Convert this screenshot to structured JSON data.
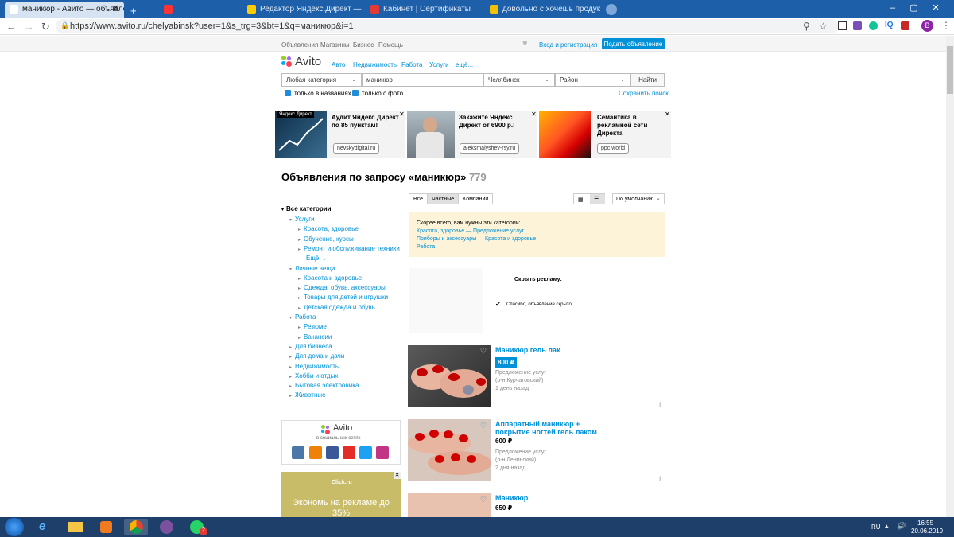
{
  "browser": {
    "tabs": [
      {
        "label": "маникюр - Авито — объявлени"
      },
      {
        "label": ""
      },
      {
        "label": "Редактор Яндекс.Директ — Сер"
      },
      {
        "label": "Кабинет | Сертификаты"
      },
      {
        "label": "довольно с хочешь продукт д..."
      },
      {
        "label": ""
      }
    ],
    "url": "https://www.avito.ru/chelyabinsk?user=1&s_trg=3&bt=1&q=маникюр&i=1",
    "profile_letter": "В"
  },
  "topnav": {
    "links": [
      "Объявления",
      "Магазины",
      "Бизнес",
      "Помощь"
    ],
    "login": "Вход и регистрация",
    "post_button": "Подать объявление"
  },
  "header": {
    "logo": "Avito",
    "menu": [
      "Авто",
      "Недвижимость",
      "Работа",
      "Услуги",
      "ещё..."
    ]
  },
  "search": {
    "category": "Любая категория",
    "query": "маникюр",
    "city": "Челябинск",
    "district": "Район",
    "submit": "Найти",
    "only_titles": "только в названиях",
    "only_photo": "только с фото",
    "save_search": "Сохранить поиск"
  },
  "ads": [
    {
      "badge": "Яндекс.Директ",
      "title": "Аудит Яндекс Директ по 85 пунктам!",
      "button": "nevskydigital.ru"
    },
    {
      "title": "Закажите Яндекс Директ от 6900 р.!",
      "button": "aleksmalyshev-rsy.ru"
    },
    {
      "title": "Семантика в рекламной сети Директа",
      "button": "ppc.world"
    }
  ],
  "results": {
    "heading": "Объявления по запросу «маникюр»",
    "count": "779",
    "seller_tabs": [
      "Все",
      "Частные",
      "Компании"
    ],
    "sort": "По умолчанию"
  },
  "suggest": {
    "title": "Скорее всего, вам нужны эти категории:",
    "items": [
      "Красота, здоровье — Предложение услуг",
      "Приборы и аксессуары — Красота и здоровье",
      "Работа"
    ]
  },
  "hidden_ad": {
    "title": "Скрыть рекламу:",
    "thanks": "Спасибо, объявление скрыто."
  },
  "sidebar": {
    "root": "Все категории",
    "items": [
      {
        "label": "Услуги",
        "level": 1
      },
      {
        "label": "Красота, здоровье",
        "level": 2
      },
      {
        "label": "Обучение, курсы",
        "level": 2
      },
      {
        "label": "Ремонт и обслуживание техники",
        "level": 2
      },
      {
        "label": "Ещё",
        "level": 2
      },
      {
        "label": "Личные вещи",
        "level": 1
      },
      {
        "label": "Красота и здоровье",
        "level": 2
      },
      {
        "label": "Одежда, обувь, аксессуары",
        "level": 2
      },
      {
        "label": "Товары для детей и игрушки",
        "level": 2
      },
      {
        "label": "Детская одежда и обувь",
        "level": 2
      },
      {
        "label": "Работа",
        "level": 1
      },
      {
        "label": "Резюме",
        "level": 2
      },
      {
        "label": "Вакансии",
        "level": 2
      },
      {
        "label": "Для бизнеса",
        "level": 1
      },
      {
        "label": "Для дома и дачи",
        "level": 1
      },
      {
        "label": "Недвижимость",
        "level": 1
      },
      {
        "label": "Хобби и отдых",
        "level": 1
      },
      {
        "label": "Бытовая электроника",
        "level": 1
      },
      {
        "label": "Животные",
        "level": 1
      }
    ]
  },
  "social": {
    "logo": "Avito",
    "caption": "в социальных сетях"
  },
  "promo": {
    "brand": "Click.ru",
    "text": "Экономь на рекламе до 35%"
  },
  "listings": [
    {
      "title": "Маникюр гель лак",
      "price": "800 ₽",
      "category": "Предложение услуг",
      "district": "(р-н Курчатовский)",
      "date": "1 день назад",
      "highlighted": true
    },
    {
      "title": "Аппаратный маникюр + покрытие ногтей гель лаком",
      "price": "600 ₽",
      "category": "Предложение услуг",
      "district": "(р-н Ленинский)",
      "date": "2 дня назад",
      "highlighted": false
    },
    {
      "title": "Маникюр",
      "price": "650 ₽",
      "category": "",
      "district": "",
      "date": "",
      "highlighted": false
    }
  ],
  "taskbar": {
    "lang": "RU",
    "time": "16:55",
    "date": "20.06.2019",
    "whatsapp_badge": "2"
  },
  "colors": {
    "link": "#0091d9",
    "post_button": "#0091d9",
    "suggest_bg": "#fdf3d8",
    "tabbar": "#1d5fa8",
    "taskbar": "#1f3f6b"
  }
}
